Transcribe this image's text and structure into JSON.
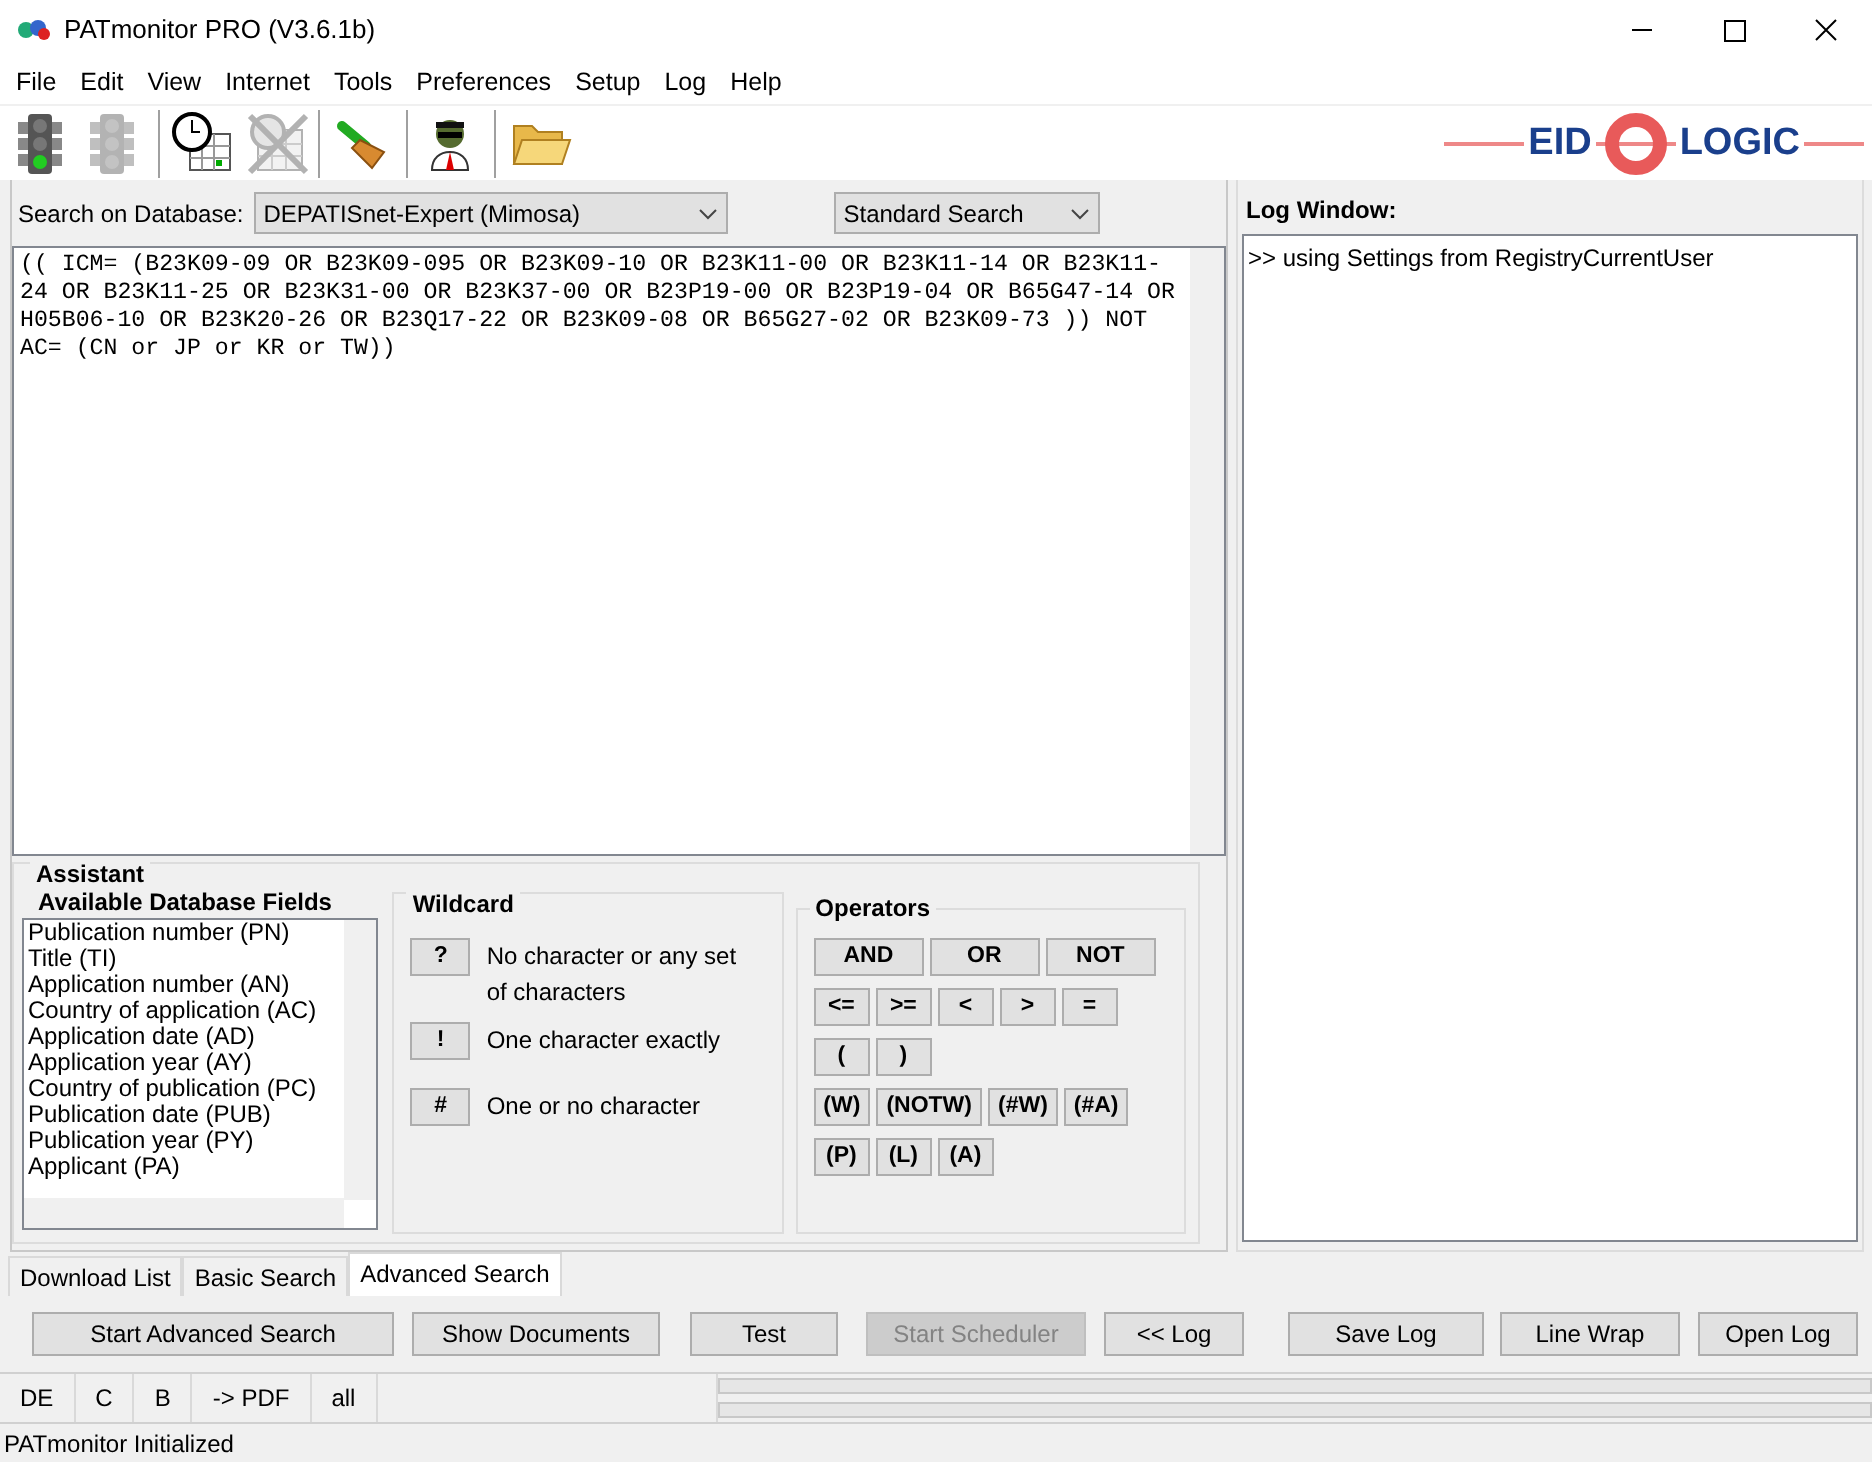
{
  "window": {
    "title": "PATmonitor PRO (V3.6.1b)"
  },
  "menu": [
    "File",
    "Edit",
    "View",
    "Internet",
    "Tools",
    "Preferences",
    "Setup",
    "Log",
    "Help"
  ],
  "toolbar": [
    {
      "kind": "traffic-light",
      "disabled": false
    },
    {
      "kind": "traffic-light",
      "disabled": true
    },
    {
      "kind": "separator"
    },
    {
      "kind": "clock-calendar",
      "disabled": false
    },
    {
      "kind": "calendar-cross",
      "disabled": true
    },
    {
      "kind": "separator"
    },
    {
      "kind": "broom",
      "disabled": false
    },
    {
      "kind": "separator"
    },
    {
      "kind": "agent",
      "disabled": false
    },
    {
      "kind": "separator"
    },
    {
      "kind": "folder",
      "disabled": false
    }
  ],
  "logo": {
    "left": "EID",
    "right": "LOGIC"
  },
  "search": {
    "label": "Search on Database:",
    "database": "DEPATISnet-Expert (Mimosa)",
    "mode": "Standard Search",
    "query": "(( ICM= (B23K09-09 OR B23K09-095 OR B23K09-10 OR B23K11-00 OR B23K11-14 OR B23K11-24 OR B23K11-25 OR B23K31-00 OR B23K37-00 OR B23P19-00 OR B23P19-04 OR B65G47-14 OR H05B06-10 OR B23K20-26 OR B23Q17-22 OR B23K09-08 OR B65G27-02 OR B23K09-73 )) NOT AC= (CN or JP or KR or TW))"
  },
  "log": {
    "title": "Log Window:",
    "lines": [
      ">> using Settings from RegistryCurrentUser"
    ]
  },
  "assistant": {
    "title": "Assistant",
    "fields_title": "Available Database Fields",
    "fields": [
      "Publication number (PN)",
      "Title (TI)",
      "Application number (AN)",
      "Country of application (AC)",
      "Application date (AD)",
      "Application year (AY)",
      "Country of publication (PC)",
      "Publication date (PUB)",
      "Publication year (PY)",
      "Applicant (PA)"
    ],
    "wildcard_title": "Wildcard",
    "wildcards": [
      {
        "symbol": "?",
        "description": "No character or any set of characters"
      },
      {
        "symbol": "!",
        "description": "One character exactly"
      },
      {
        "symbol": "#",
        "description": "One or no character"
      }
    ],
    "operators_title": "Operators",
    "operators": [
      [
        "AND",
        "OR",
        "NOT"
      ],
      [
        "<=",
        ">=",
        "<",
        ">",
        "="
      ],
      [
        "(",
        ")"
      ],
      [
        "(W)",
        "(NOTW)",
        "(#W)",
        "(#A)"
      ],
      [
        "(P)",
        "(L)",
        "(A)"
      ]
    ]
  },
  "tabs": [
    {
      "label": "Download List",
      "selected": false
    },
    {
      "label": "Basic Search",
      "selected": false
    },
    {
      "label": "Advanced Search",
      "selected": true
    }
  ],
  "buttons": [
    {
      "label": "Start Advanced Search",
      "disabled": false
    },
    {
      "label": "Show Documents",
      "disabled": false
    },
    {
      "label": "Test",
      "disabled": false
    },
    {
      "label": "Start Scheduler",
      "disabled": true
    },
    {
      "label": "<< Log",
      "disabled": false
    },
    {
      "label": "Save Log",
      "disabled": false
    },
    {
      "label": "Line Wrap",
      "disabled": false
    },
    {
      "label": "Open Log",
      "disabled": false
    }
  ],
  "status_cells": [
    "DE",
    "C",
    "B",
    "-> PDF",
    "all"
  ],
  "status_message": "PATmonitor Initialized"
}
